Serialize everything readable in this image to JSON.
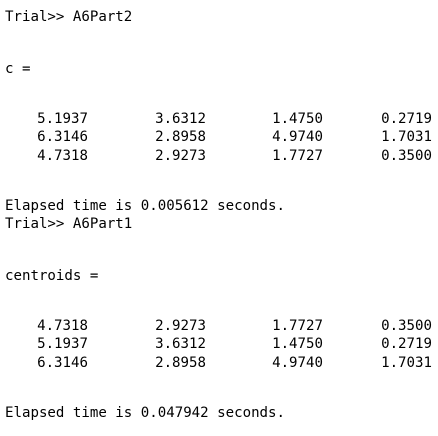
{
  "console": {
    "prompt1": "Trial>> A6Part2",
    "var1_label": "c =",
    "matrix1": [
      [
        "5.1937",
        "3.6312",
        "1.4750",
        "0.2719"
      ],
      [
        "6.3146",
        "2.8958",
        "4.9740",
        "1.7031"
      ],
      [
        "4.7318",
        "2.9273",
        "1.7727",
        "0.3500"
      ]
    ],
    "elapsed1": "Elapsed time is 0.005612 seconds.",
    "prompt2": "Trial>> A6Part1",
    "var2_label": "centroids =",
    "matrix2": [
      [
        "4.7318",
        "2.9273",
        "1.7727",
        "0.3500"
      ],
      [
        "5.1937",
        "3.6312",
        "1.4750",
        "0.2719"
      ],
      [
        "6.3146",
        "2.8958",
        "4.9740",
        "1.7031"
      ]
    ],
    "elapsed2": "Elapsed time is 0.047942 seconds."
  },
  "colors": {
    "background": "#ffffff",
    "text": "#000000"
  }
}
